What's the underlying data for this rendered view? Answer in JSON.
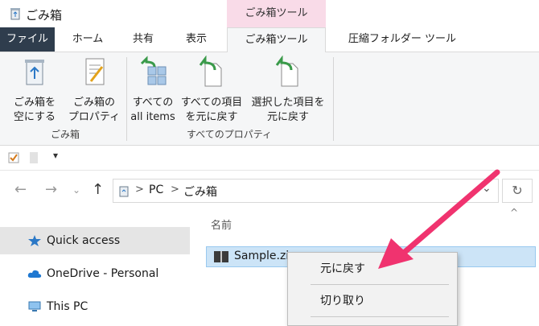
{
  "window": {
    "title": "ごみ箱",
    "context_group": "ごみ箱ツール"
  },
  "tabs": {
    "file": "ファイル",
    "home": "ホーム",
    "share": "共有",
    "view": "表示",
    "manage": "ごみ箱ツール",
    "zip": "圧縮フォルダー ツール"
  },
  "ribbon": {
    "empty": [
      "ごみ箱を",
      "空にする"
    ],
    "props": [
      "ごみ箱の",
      "プロパティ"
    ],
    "group1": "ごみ箱",
    "restore_all": [
      "すべての",
      "all items"
    ],
    "restore_all2": [
      "すべての項目",
      "を元に戻す"
    ],
    "restore_sel": [
      "選択した項目を",
      "元に戻す"
    ],
    "group2": "すべてのプロパティ"
  },
  "address": {
    "pc": "PC",
    "folder": "ごみ箱",
    "sep": ">"
  },
  "nav": {
    "quick": "Quick access",
    "onedrive": "OneDrive - Personal",
    "thispc": "This PC"
  },
  "list": {
    "col_name": "名前",
    "file": "Sample.zi"
  },
  "menu": {
    "restore": "元に戻す",
    "cut": "切り取り"
  },
  "colors": {
    "file_tab": "#2f3d4d",
    "context_tab": "#f9dbe8",
    "selection": "#cce4f7",
    "arrow": "#f0336f"
  }
}
